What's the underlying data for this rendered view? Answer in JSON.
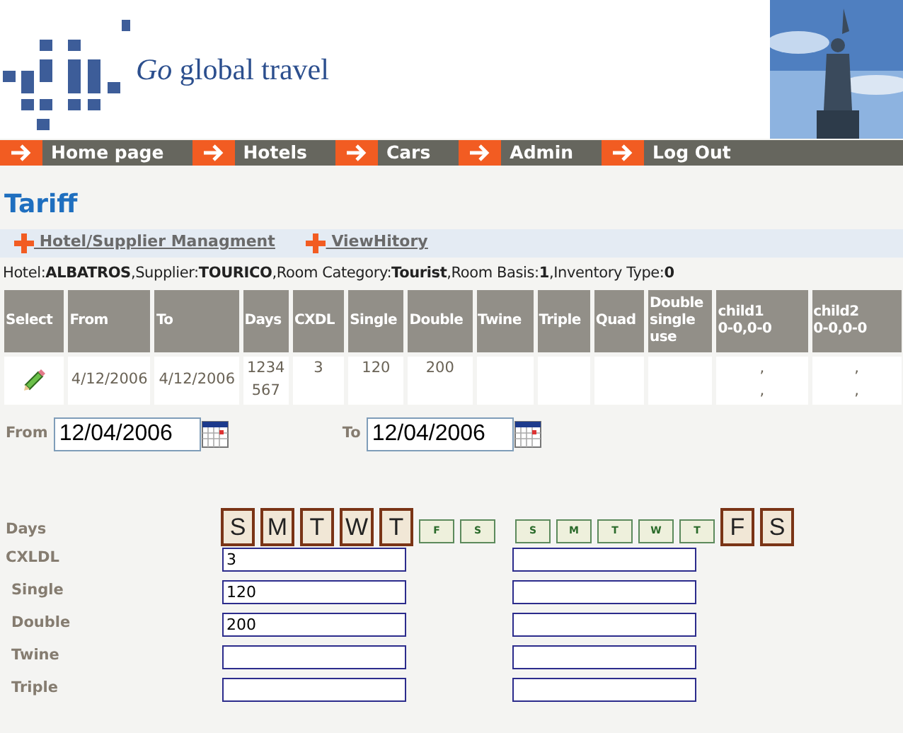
{
  "logo": {
    "text": "*Go* global travel"
  },
  "nav": [
    {
      "label": "Home page"
    },
    {
      "label": "Hotels"
    },
    {
      "label": "Cars"
    },
    {
      "label": "Admin"
    },
    {
      "label": "Log Out"
    }
  ],
  "title": "Tariff",
  "links": [
    {
      "label": " Hotel/Supplier Managment"
    },
    {
      "label": " ViewHitory"
    }
  ],
  "info": "Hotel:**ALBATROS**,Supplier:**TOURICO**,Room Category:**Tourist**,Room Basis:**1**,Inventory Type:**0**",
  "table": {
    "columns": [
      "Select",
      "From",
      "To",
      "Days",
      "CXDL",
      "Single",
      "Double",
      "Twine",
      "Triple",
      "Quad",
      "Double single use",
      "child1 0-0,0-0",
      "child2 0-0,0-0"
    ],
    "rows": [
      {
        "cells": [
          null,
          "4/12/2006",
          "4/12/2006",
          "1234567",
          "3",
          "120",
          "200",
          null,
          null,
          null,
          null,
          ", ,",
          ", ,"
        ]
      }
    ]
  },
  "date_range": [
    {
      "label": "From",
      "value": "12/04/2006"
    },
    {
      "label": "To",
      "value": "12/04/2006"
    }
  ],
  "days": {
    "label": "Days",
    "groups": [
      [
        {
          "label": "S",
          "selected": true
        },
        {
          "label": "M",
          "selected": true
        },
        {
          "label": "T",
          "selected": true
        },
        {
          "label": "W",
          "selected": true
        },
        {
          "label": "T",
          "selected": true
        },
        {
          "label": "F",
          "selected": false
        },
        {
          "label": "S",
          "selected": false
        }
      ],
      [
        {
          "label": "S",
          "selected": false
        },
        {
          "label": "M",
          "selected": false
        },
        {
          "label": "T",
          "selected": false
        },
        {
          "label": "W",
          "selected": false
        },
        {
          "label": "T",
          "selected": false
        },
        {
          "label": "F",
          "selected": true
        },
        {
          "label": "S",
          "selected": true
        }
      ]
    ]
  },
  "price_rows": [
    {
      "label": "CXLDL",
      "fields": [
        {
          "kind": "text",
          "value": "3"
        },
        {
          "kind": "text"
        }
      ]
    },
    {
      "label": "Single",
      "fields": [
        {
          "kind": "text",
          "value": "120"
        },
        {
          "kind": "text"
        }
      ]
    },
    {
      "label": "Double",
      "fields": [
        {
          "kind": "text",
          "value": "200"
        },
        {
          "kind": "text"
        }
      ]
    },
    {
      "label": "Twine",
      "fields": [
        {
          "kind": "text"
        },
        {
          "kind": "text"
        }
      ]
    },
    {
      "label": "Triple",
      "fields": [
        {
          "kind": "text"
        },
        {
          "kind": "text"
        }
      ]
    }
  ]
}
